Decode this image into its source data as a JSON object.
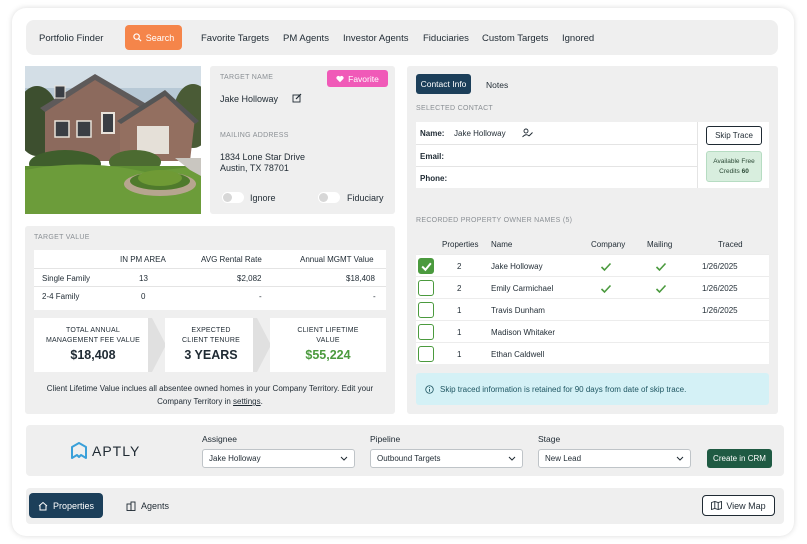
{
  "nav": {
    "brand": "Portfolio Finder",
    "search_label": "Search",
    "items": [
      "Favorite Targets",
      "PM Agents",
      "Investor Agents",
      "Fiduciaries",
      "Custom Targets",
      "Ignored"
    ]
  },
  "target": {
    "name_label": "TARGET NAME",
    "name": "Jake Holloway",
    "favorite_label": "Favorite",
    "mailing_label": "MAILING ADDRESS",
    "address_line1": "1834 Lone Star Drive",
    "address_line2": "Austin, TX 78701",
    "ignore_label": "Ignore",
    "fiduciary_label": "Fiduciary"
  },
  "target_value": {
    "title": "TARGET VALUE",
    "headers": [
      "IN PM AREA",
      "AVG Rental Rate",
      "Annual MGMT Value"
    ],
    "rows": [
      {
        "type": "Single Family",
        "in_pm_area": "13",
        "avg_rental": "$2,082",
        "annual_mgmt": "$18,408"
      },
      {
        "type": "2-4 Family",
        "in_pm_area": "0",
        "avg_rental": "-",
        "annual_mgmt": "-"
      }
    ],
    "summary": [
      {
        "title_line1": "TOTAL ANNUAL",
        "title_line2": "MANAGEMENT FEE VALUE",
        "value": "$18,408"
      },
      {
        "title_line1": "EXPECTED",
        "title_line2": "CLIENT TENURE",
        "value": "3 YEARS"
      },
      {
        "title_line1": "CLIENT LIFETIME",
        "title_line2": "VALUE",
        "value": "$55,224"
      }
    ],
    "note_line1": "Client Lifetime Value inclues all absentee owned homes in your Company Territory. Edit your",
    "note_line2_prefix": "Company Territory in ",
    "note_link": "settings",
    "note_suffix": "."
  },
  "contact": {
    "tabs": [
      "Contact Info",
      "Notes"
    ],
    "selected_label": "SELECTED CONTACT",
    "name_label": "Name:",
    "name_value": "Jake Holloway",
    "email_label": "Email:",
    "phone_label": "Phone:",
    "skip_trace_label": "Skip Trace",
    "credits_line1": "Available Free",
    "credits_line2": "Credits",
    "credits_count": "60",
    "owners_label": "RECORDED PROPERTY OWNER NAMES (5)",
    "owner_headers": [
      "Properties",
      "Name",
      "Company",
      "Mailing",
      "Traced"
    ],
    "owners": [
      {
        "checked": true,
        "properties": "2",
        "name": "Jake Holloway",
        "company": true,
        "mailing": true,
        "traced": "1/26/2025"
      },
      {
        "checked": false,
        "properties": "2",
        "name": "Emily Carmichael",
        "company": true,
        "mailing": true,
        "traced": "1/26/2025"
      },
      {
        "checked": false,
        "properties": "1",
        "name": "Travis Dunham",
        "company": false,
        "mailing": false,
        "traced": "1/26/2025"
      },
      {
        "checked": false,
        "properties": "1",
        "name": "Madison Whitaker",
        "company": false,
        "mailing": false,
        "traced": ""
      },
      {
        "checked": false,
        "properties": "1",
        "name": "Ethan Caldwell",
        "company": false,
        "mailing": false,
        "traced": ""
      }
    ],
    "info_text": "Skip traced information is retained for 90 days from date of skip trace."
  },
  "assign": {
    "logo_text": "APTLY",
    "assignee_label": "Assignee",
    "assignee_value": "Jake Holloway",
    "pipeline_label": "Pipeline",
    "pipeline_value": "Outbound Targets",
    "stage_label": "Stage",
    "stage_value": "New Lead",
    "crm_label": "Create in CRM"
  },
  "footer": {
    "properties_label": "Properties",
    "agents_label": "Agents",
    "view_map_label": "View Map"
  },
  "colors": {
    "accent_orange": "#f5854a",
    "favorite_pink": "#f05ab8",
    "navy": "#1c3f5a",
    "green": "#4b9a3e",
    "crm_green": "#1f5a43",
    "info_cyan": "#d4f1f6"
  }
}
